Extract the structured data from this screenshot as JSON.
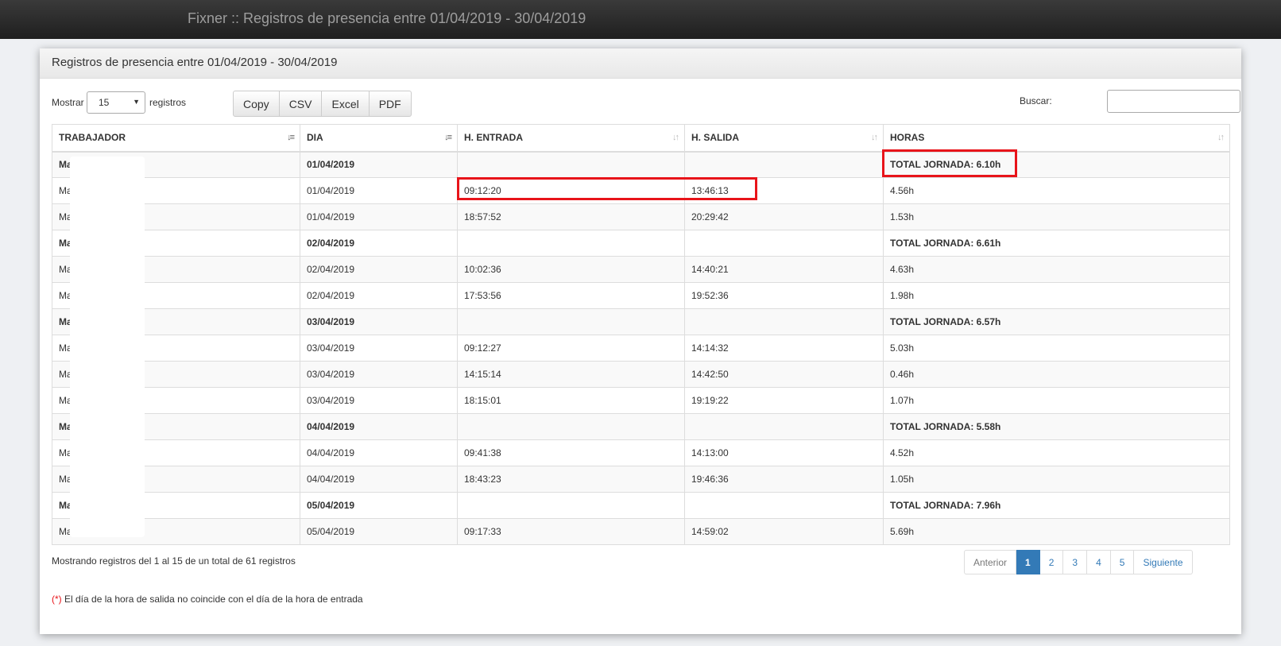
{
  "app": {
    "title": "Fixner :: Registros de presencia entre 01/04/2019 - 30/04/2019"
  },
  "panel": {
    "heading": "Registros de presencia entre 01/04/2019 - 30/04/2019"
  },
  "length": {
    "prefix": "Mostrar",
    "value": "15",
    "suffix": "registros"
  },
  "buttons": {
    "copy": "Copy",
    "csv": "CSV",
    "excel": "Excel",
    "pdf": "PDF"
  },
  "search": {
    "label": "Buscar:",
    "value": ""
  },
  "icons": {
    "sort_active": "sort-ascending-icon",
    "sort_inactive": "sort-both-icon",
    "dropdown": "caret-down-icon"
  },
  "table": {
    "headers": [
      "TRABAJADOR",
      "DIA",
      "H. ENTRADA",
      "H. SALIDA",
      "HORAS"
    ],
    "rows": [
      {
        "worker": "Ma",
        "day": "01/04/2019",
        "in": "",
        "out": "",
        "hours": "TOTAL JORNADA: 6.10h",
        "total": true
      },
      {
        "worker": "Ma",
        "day": "01/04/2019",
        "in": "09:12:20",
        "out": "13:46:13",
        "hours": "4.56h",
        "total": false
      },
      {
        "worker": "Ma",
        "day": "01/04/2019",
        "in": "18:57:52",
        "out": "20:29:42",
        "hours": "1.53h",
        "total": false
      },
      {
        "worker": "Ma",
        "day": "02/04/2019",
        "in": "",
        "out": "",
        "hours": "TOTAL JORNADA: 6.61h",
        "total": true
      },
      {
        "worker": "Ma",
        "day": "02/04/2019",
        "in": "10:02:36",
        "out": "14:40:21",
        "hours": "4.63h",
        "total": false
      },
      {
        "worker": "Ma",
        "day": "02/04/2019",
        "in": "17:53:56",
        "out": "19:52:36",
        "hours": "1.98h",
        "total": false
      },
      {
        "worker": "Ma",
        "day": "03/04/2019",
        "in": "",
        "out": "",
        "hours": "TOTAL JORNADA: 6.57h",
        "total": true
      },
      {
        "worker": "Ma",
        "day": "03/04/2019",
        "in": "09:12:27",
        "out": "14:14:32",
        "hours": "5.03h",
        "total": false
      },
      {
        "worker": "Ma",
        "day": "03/04/2019",
        "in": "14:15:14",
        "out": "14:42:50",
        "hours": "0.46h",
        "total": false
      },
      {
        "worker": "Ma",
        "day": "03/04/2019",
        "in": "18:15:01",
        "out": "19:19:22",
        "hours": "1.07h",
        "total": false
      },
      {
        "worker": "Ma",
        "day": "04/04/2019",
        "in": "",
        "out": "",
        "hours": "TOTAL JORNADA: 5.58h",
        "total": true
      },
      {
        "worker": "Ma",
        "day": "04/04/2019",
        "in": "09:41:38",
        "out": "14:13:00",
        "hours": "4.52h",
        "total": false
      },
      {
        "worker": "Ma",
        "day": "04/04/2019",
        "in": "18:43:23",
        "out": "19:46:36",
        "hours": "1.05h",
        "total": false
      },
      {
        "worker": "Ma",
        "day": "05/04/2019",
        "in": "",
        "out": "",
        "hours": "TOTAL JORNADA: 7.96h",
        "total": true
      },
      {
        "worker": "Ma",
        "day": "05/04/2019",
        "in": "09:17:33",
        "out": "14:59:02",
        "hours": "5.69h",
        "total": false
      }
    ]
  },
  "footer": {
    "info": "Mostrando registros del 1 al 15 de un total de 61 registros",
    "pagination": {
      "prev": "Anterior",
      "pages": [
        "1",
        "2",
        "3",
        "4",
        "5"
      ],
      "current": "1",
      "next": "Siguiente"
    }
  },
  "note": {
    "marker": "(*)",
    "text": " El día de la hora de salida no coincide con el día de la hora de entrada"
  },
  "colors": {
    "highlight": "#e8141a",
    "accent": "#337ab7"
  }
}
